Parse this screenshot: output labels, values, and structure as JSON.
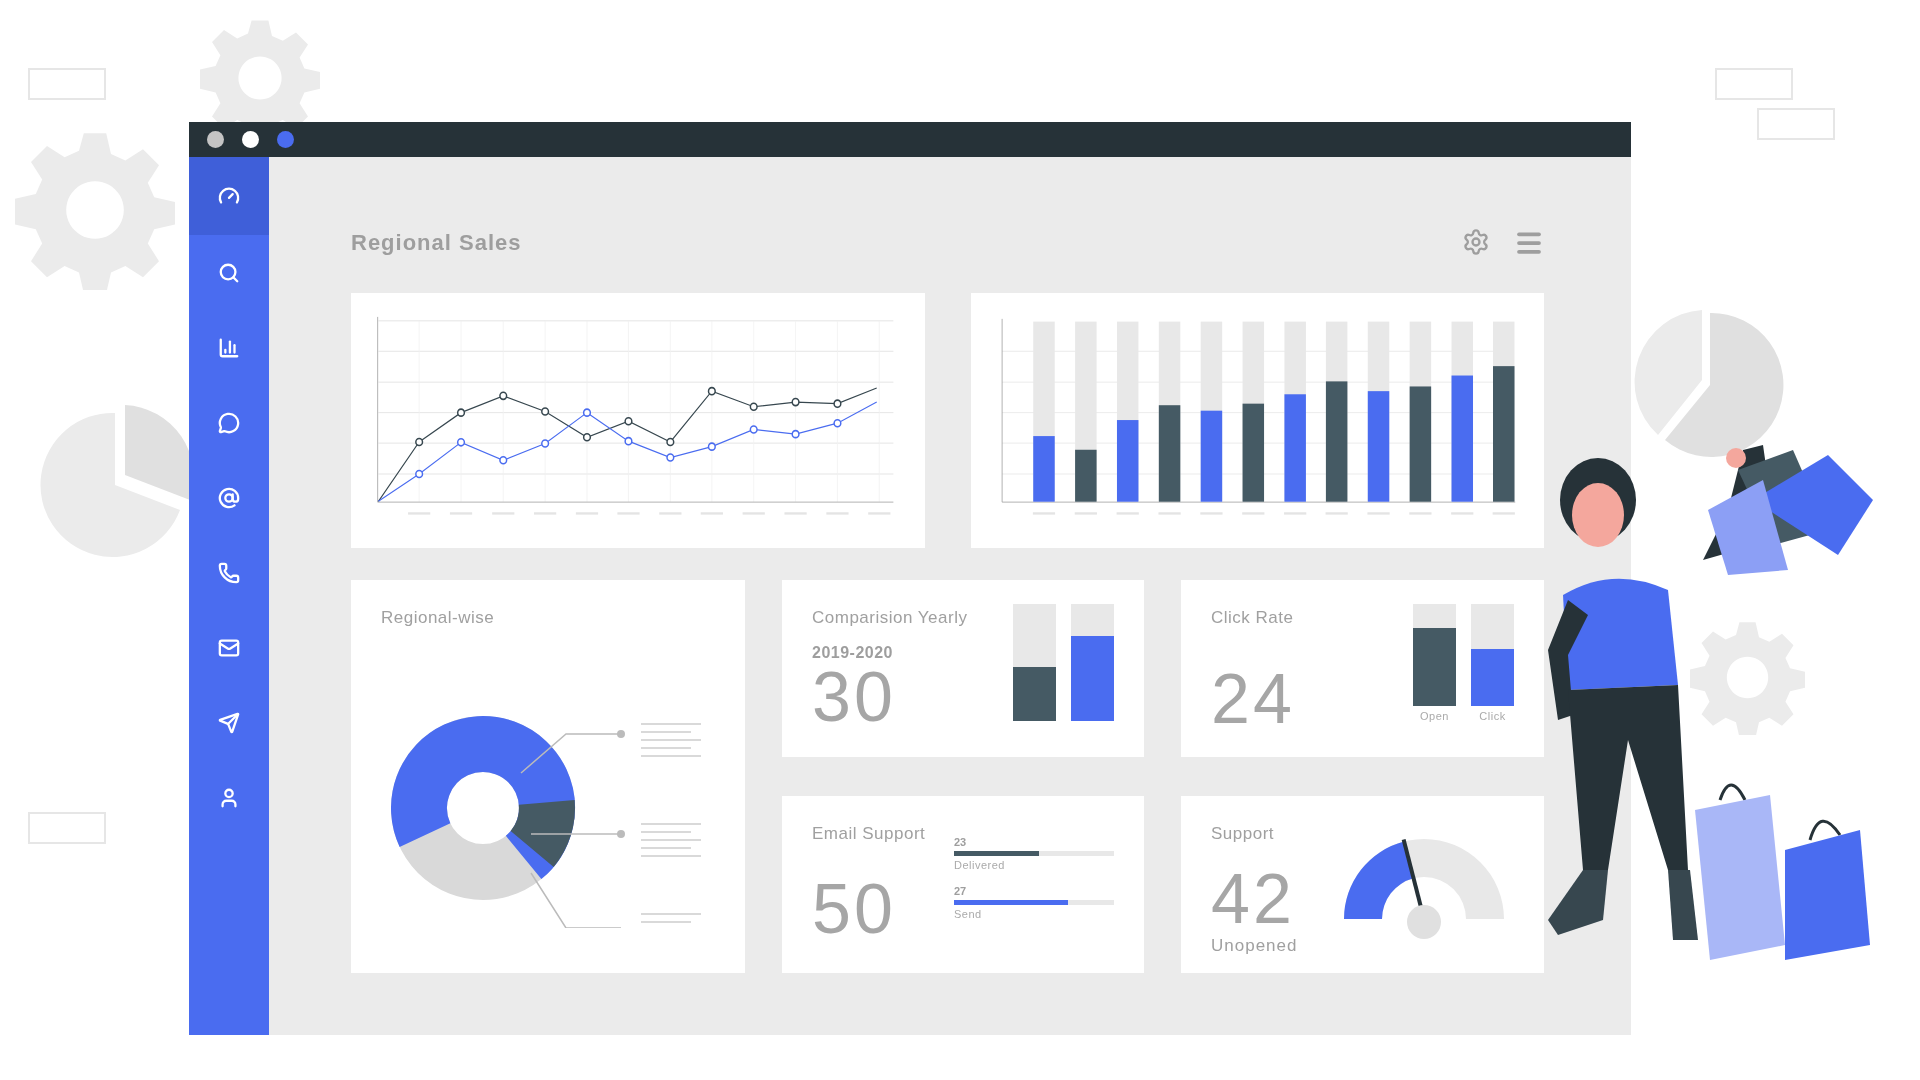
{
  "sidebar": {
    "items": [
      {
        "selected": true
      },
      {
        "selected": false
      },
      {
        "selected": false
      },
      {
        "selected": false
      },
      {
        "selected": false
      },
      {
        "selected": false
      },
      {
        "selected": false
      },
      {
        "selected": false
      },
      {
        "selected": false
      }
    ]
  },
  "header": {
    "title": "Regional Sales"
  },
  "regional": {
    "title": "Regional-wise"
  },
  "comparison": {
    "title": "Comparision Yearly",
    "period": "2019-2020",
    "value": "30",
    "bars": [
      {
        "kind": "dark",
        "level": 0.46
      },
      {
        "kind": "blue",
        "level": 0.73
      }
    ]
  },
  "click_rate": {
    "title": "Click Rate",
    "value": "24",
    "bars": [
      {
        "kind": "dark",
        "label": "Open",
        "level": 0.76
      },
      {
        "kind": "blue",
        "label": "Click",
        "level": 0.56
      }
    ]
  },
  "email_support": {
    "title": "Email Support",
    "value": "50",
    "meters": [
      {
        "kind": "dark",
        "count": "23",
        "label": "Delivered",
        "level": 0.53
      },
      {
        "kind": "blue",
        "count": "27",
        "label": "Send",
        "level": 0.71
      }
    ]
  },
  "support": {
    "title": "Support",
    "value": "42",
    "caption": "Unopened",
    "level": 0.42
  }
}
